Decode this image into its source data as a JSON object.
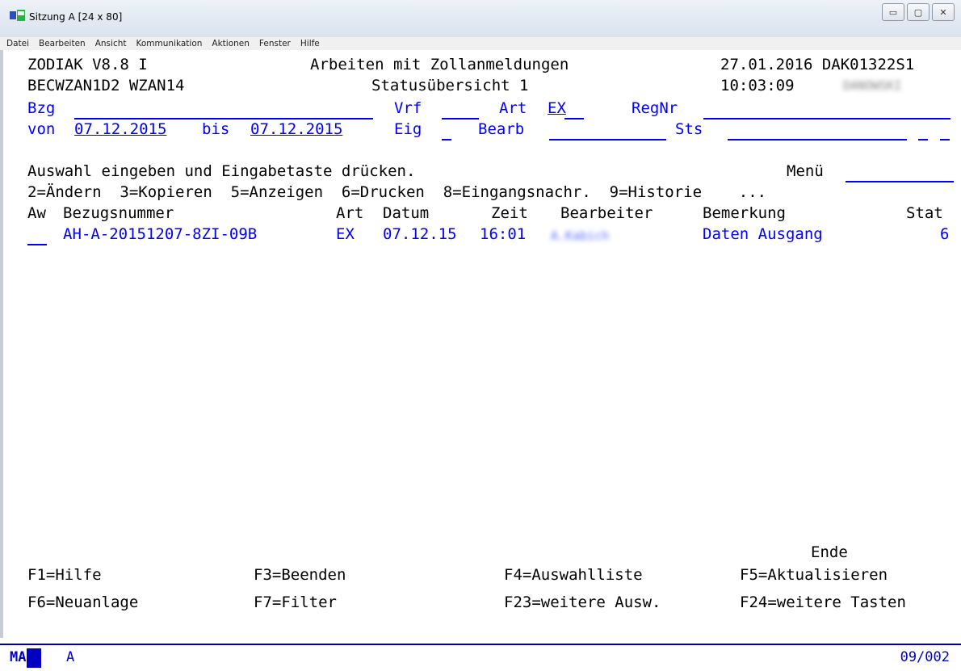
{
  "window": {
    "title": "Sitzung A [24 x 80]"
  },
  "menu": [
    "Datei",
    "Bearbeiten",
    "Ansicht",
    "Kommunikation",
    "Aktionen",
    "Fenster",
    "Hilfe"
  ],
  "header": {
    "line1_left": "ZODIAK V8.8 I",
    "line1_center": "Arbeiten mit Zollanmeldungen",
    "line1_right": "27.01.2016 DAK01322S1",
    "line2_left": "BECWZAN1D2 WZAN14",
    "line2_center": "Statusübersicht 1",
    "line2_time": "10:03:09",
    "line2_user": "DANOWSKI"
  },
  "filters": {
    "bzg_label": "Bzg",
    "vrf_label": "Vrf",
    "art_label": "Art",
    "art_value": "EX",
    "regnr_label": "RegNr",
    "von_label": "von",
    "von_value": "07.12.2015",
    "bis_label": "bis",
    "bis_value": "07.12.2015",
    "eig_label": "Eig",
    "bearb_label": "Bearb",
    "sts_label": "Sts"
  },
  "instructions": {
    "prompt": "Auswahl eingeben und Eingabetaste drücken.",
    "menu_label": "Menü",
    "options": "2=Ändern  3=Kopieren  5=Anzeigen  6=Drucken  8=Eingangsnachr.  9=Historie    ..."
  },
  "table": {
    "headers": {
      "aw": "Aw",
      "bezugsnummer": "Bezugsnummer",
      "art": "Art",
      "datum": "Datum",
      "zeit": "Zeit",
      "bearbeiter": "Bearbeiter",
      "bemerkung": "Bemerkung",
      "stat": "Stat"
    },
    "rows": [
      {
        "bezugsnummer": "AH-A-20151207-8ZI-09B",
        "art": "EX",
        "datum": "07.12.15",
        "zeit": "16:01",
        "bearbeiter": "A.Kabich",
        "bemerkung": "Daten Ausgang",
        "stat": "6"
      }
    ]
  },
  "footer": {
    "ende": "Ende",
    "f1": "F1=Hilfe",
    "f3": "F3=Beenden",
    "f4": "F4=Auswahlliste",
    "f5": "F5=Aktualisieren",
    "f6": "F6=Neuanlage",
    "f7": "F7=Filter",
    "f23": "F23=weitere Ausw.",
    "f24": "F24=weitere Tasten"
  },
  "status": {
    "mode": "MA",
    "indicator": "A",
    "cursor": "09/002"
  }
}
